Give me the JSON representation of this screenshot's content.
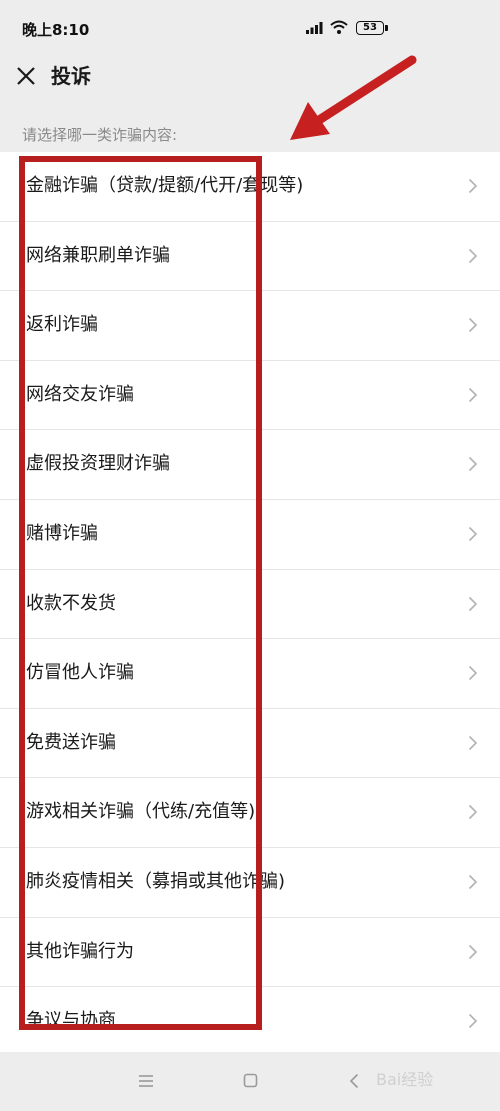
{
  "status_bar": {
    "time": "晚上8:10",
    "battery": "53",
    "icons": [
      "signal-icon",
      "wifi-icon",
      "battery-icon"
    ]
  },
  "header": {
    "title": "投诉",
    "close_icon": "close-icon"
  },
  "section_hint": "请选择哪一类诈骗内容:",
  "list": {
    "items": [
      {
        "label": "金融诈骗（贷款/提额/代开/套现等)"
      },
      {
        "label": "网络兼职刷单诈骗"
      },
      {
        "label": "返利诈骗"
      },
      {
        "label": "网络交友诈骗"
      },
      {
        "label": "虚假投资理财诈骗"
      },
      {
        "label": "赌博诈骗"
      },
      {
        "label": "收款不发货"
      },
      {
        "label": "仿冒他人诈骗"
      },
      {
        "label": "免费送诈骗"
      },
      {
        "label": "游戏相关诈骗（代练/充值等)"
      },
      {
        "label": "肺炎疫情相关（募捐或其他诈骗)"
      },
      {
        "label": "其他诈骗行为"
      },
      {
        "label": "争议与协商"
      }
    ]
  },
  "nav_bar": {
    "icons": [
      "menu-icon",
      "home-icon",
      "back-icon"
    ],
    "watermark": "Bai经验"
  },
  "colors": {
    "background": "#ededed",
    "list_background": "#ffffff",
    "annotation_red": "#b71e1e",
    "hint_text": "#8a8a8a"
  }
}
